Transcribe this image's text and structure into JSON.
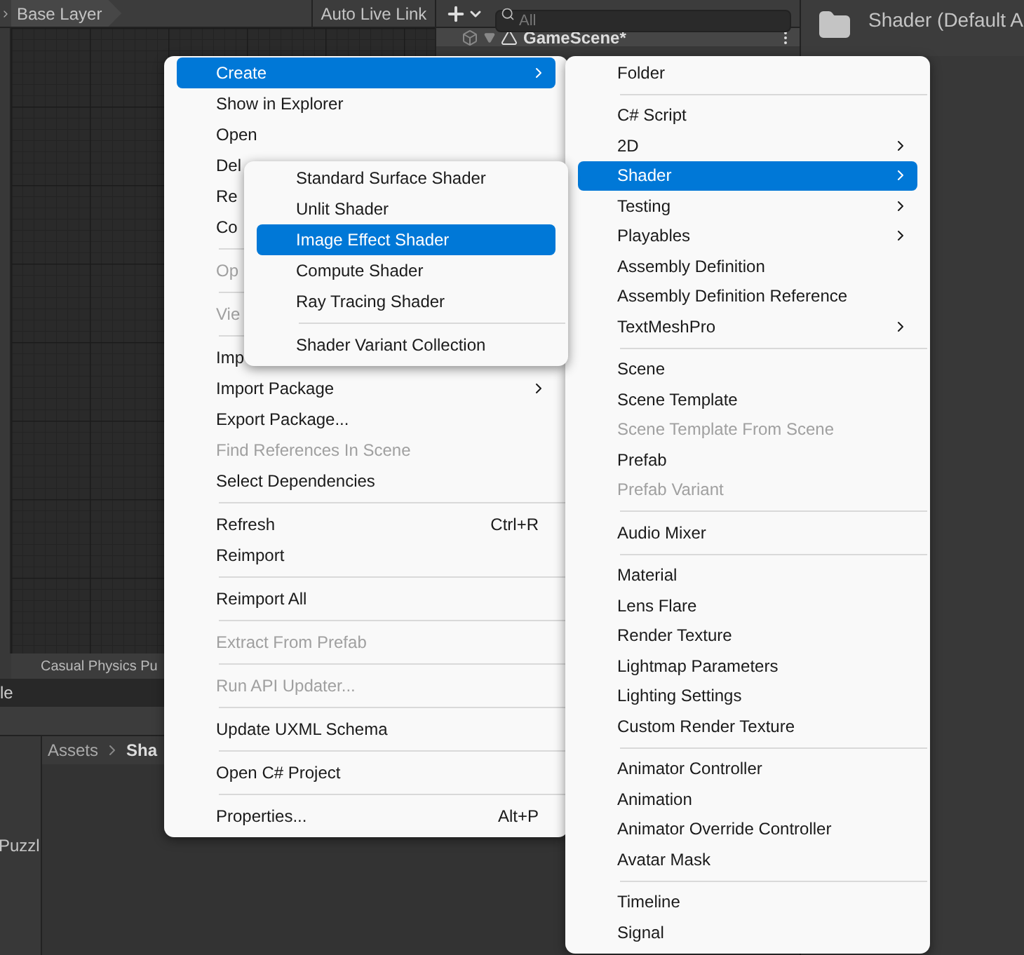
{
  "animator": {
    "breadcrumb": "Base Layer",
    "live_link": "Auto Live Link",
    "footer": "Casual Physics Pu"
  },
  "hierarchy": {
    "search": {
      "placeholder": "All"
    },
    "scene": "GameScene*"
  },
  "inspector": {
    "title": "Shader (Default A"
  },
  "project": {
    "tab": "le",
    "breadcrumb": [
      "Assets",
      "Sha"
    ],
    "folder": "Puzzl"
  },
  "context_menu": {
    "items": [
      {
        "kind": "item",
        "label": "Create",
        "selected": true,
        "disabled": false,
        "submenu": true
      },
      {
        "kind": "item",
        "label": "Show in Explorer",
        "selected": false,
        "disabled": false,
        "submenu": false
      },
      {
        "kind": "item",
        "label": "Open",
        "selected": false,
        "disabled": false,
        "submenu": false
      },
      {
        "kind": "item",
        "label": "Del",
        "selected": false,
        "disabled": false
      },
      {
        "kind": "item",
        "label": "Re",
        "selected": false,
        "disabled": false
      },
      {
        "kind": "item",
        "label": "Co",
        "selected": false,
        "disabled": false
      },
      {
        "kind": "separator"
      },
      {
        "kind": "item",
        "label": "Op",
        "selected": false,
        "disabled": true
      },
      {
        "kind": "separator"
      },
      {
        "kind": "item",
        "label": "Vie",
        "selected": false,
        "disabled": true
      },
      {
        "kind": "separator"
      },
      {
        "kind": "item",
        "label": "Imp",
        "selected": false,
        "disabled": false
      },
      {
        "kind": "item",
        "label": "Import Package",
        "selected": false,
        "disabled": false,
        "submenu": true
      },
      {
        "kind": "item",
        "label": "Export Package...",
        "selected": false,
        "disabled": false,
        "submenu": false
      },
      {
        "kind": "item",
        "label": "Find References In Scene",
        "selected": false,
        "disabled": true,
        "submenu": false
      },
      {
        "kind": "item",
        "label": "Select Dependencies",
        "selected": false,
        "disabled": false,
        "submenu": false
      },
      {
        "kind": "separator"
      },
      {
        "kind": "item",
        "label": "Refresh",
        "shortcut": "Ctrl+R",
        "selected": false,
        "disabled": false,
        "submenu": false
      },
      {
        "kind": "item",
        "label": "Reimport",
        "selected": false,
        "disabled": false,
        "submenu": false
      },
      {
        "kind": "separator"
      },
      {
        "kind": "item",
        "label": "Reimport All",
        "selected": false,
        "disabled": false,
        "submenu": false
      },
      {
        "kind": "separator"
      },
      {
        "kind": "item",
        "label": "Extract From Prefab",
        "selected": false,
        "disabled": true,
        "submenu": false
      },
      {
        "kind": "separator"
      },
      {
        "kind": "item",
        "label": "Run API Updater...",
        "selected": false,
        "disabled": true,
        "submenu": false
      },
      {
        "kind": "separator"
      },
      {
        "kind": "item",
        "label": "Update UXML Schema",
        "selected": false,
        "disabled": false,
        "submenu": false
      },
      {
        "kind": "separator"
      },
      {
        "kind": "item",
        "label": "Open C# Project",
        "selected": false,
        "disabled": false,
        "submenu": false
      },
      {
        "kind": "separator"
      },
      {
        "kind": "item",
        "label": "Properties...",
        "shortcut": "Alt+P",
        "selected": false,
        "disabled": false,
        "submenu": false
      }
    ]
  },
  "create_submenu": {
    "items": [
      {
        "kind": "item",
        "label": "Folder",
        "selected": false,
        "disabled": false,
        "submenu": false
      },
      {
        "kind": "separator"
      },
      {
        "kind": "item",
        "label": "C# Script",
        "selected": false,
        "disabled": false,
        "submenu": false
      },
      {
        "kind": "item",
        "label": "2D",
        "selected": false,
        "disabled": false,
        "submenu": true
      },
      {
        "kind": "item",
        "label": "Shader",
        "selected": true,
        "disabled": false,
        "submenu": true
      },
      {
        "kind": "item",
        "label": "Testing",
        "selected": false,
        "disabled": false,
        "submenu": true
      },
      {
        "kind": "item",
        "label": "Playables",
        "selected": false,
        "disabled": false,
        "submenu": true
      },
      {
        "kind": "item",
        "label": "Assembly Definition",
        "selected": false,
        "disabled": false,
        "submenu": false
      },
      {
        "kind": "item",
        "label": "Assembly Definition Reference",
        "selected": false,
        "disabled": false,
        "submenu": false
      },
      {
        "kind": "item",
        "label": "TextMeshPro",
        "selected": false,
        "disabled": false,
        "submenu": true
      },
      {
        "kind": "separator"
      },
      {
        "kind": "item",
        "label": "Scene",
        "selected": false,
        "disabled": false,
        "submenu": false
      },
      {
        "kind": "item",
        "label": "Scene Template",
        "selected": false,
        "disabled": false,
        "submenu": false
      },
      {
        "kind": "item",
        "label": "Scene Template From Scene",
        "selected": false,
        "disabled": true,
        "submenu": false
      },
      {
        "kind": "item",
        "label": "Prefab",
        "selected": false,
        "disabled": false,
        "submenu": false
      },
      {
        "kind": "item",
        "label": "Prefab Variant",
        "selected": false,
        "disabled": true,
        "submenu": false
      },
      {
        "kind": "separator"
      },
      {
        "kind": "item",
        "label": "Audio Mixer",
        "selected": false,
        "disabled": false,
        "submenu": false
      },
      {
        "kind": "separator"
      },
      {
        "kind": "item",
        "label": "Material",
        "selected": false,
        "disabled": false,
        "submenu": false
      },
      {
        "kind": "item",
        "label": "Lens Flare",
        "selected": false,
        "disabled": false,
        "submenu": false
      },
      {
        "kind": "item",
        "label": "Render Texture",
        "selected": false,
        "disabled": false,
        "submenu": false
      },
      {
        "kind": "item",
        "label": "Lightmap Parameters",
        "selected": false,
        "disabled": false,
        "submenu": false
      },
      {
        "kind": "item",
        "label": "Lighting Settings",
        "selected": false,
        "disabled": false,
        "submenu": false
      },
      {
        "kind": "item",
        "label": "Custom Render Texture",
        "selected": false,
        "disabled": false,
        "submenu": false
      },
      {
        "kind": "separator"
      },
      {
        "kind": "item",
        "label": "Animator Controller",
        "selected": false,
        "disabled": false,
        "submenu": false
      },
      {
        "kind": "item",
        "label": "Animation",
        "selected": false,
        "disabled": false,
        "submenu": false
      },
      {
        "kind": "item",
        "label": "Animator Override Controller",
        "selected": false,
        "disabled": false,
        "submenu": false
      },
      {
        "kind": "item",
        "label": "Avatar Mask",
        "selected": false,
        "disabled": false,
        "submenu": false
      },
      {
        "kind": "separator"
      },
      {
        "kind": "item",
        "label": "Timeline",
        "selected": false,
        "disabled": false,
        "submenu": false
      },
      {
        "kind": "item",
        "label": "Signal",
        "selected": false,
        "disabled": false,
        "submenu": false
      }
    ]
  },
  "shader_submenu": {
    "items": [
      {
        "kind": "item",
        "label": "Standard Surface Shader",
        "selected": false,
        "disabled": false,
        "submenu": false
      },
      {
        "kind": "item",
        "label": "Unlit Shader",
        "selected": false,
        "disabled": false,
        "submenu": false
      },
      {
        "kind": "item",
        "label": "Image Effect Shader",
        "selected": true,
        "disabled": false,
        "submenu": false
      },
      {
        "kind": "item",
        "label": "Compute Shader",
        "selected": false,
        "disabled": false,
        "submenu": false
      },
      {
        "kind": "item",
        "label": "Ray Tracing Shader",
        "selected": false,
        "disabled": false,
        "submenu": false
      },
      {
        "kind": "separator"
      },
      {
        "kind": "item",
        "label": "Shader Variant Collection",
        "selected": false,
        "disabled": false,
        "submenu": false
      }
    ]
  }
}
